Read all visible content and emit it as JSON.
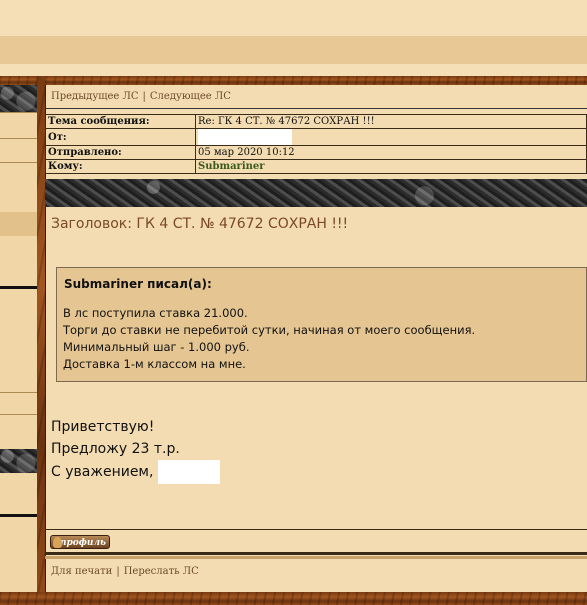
{
  "nav": {
    "prev": "Предыдущее ЛС",
    "separator": "|",
    "next": "Следующее ЛС"
  },
  "header": [
    {
      "key": "Тема сообщения:",
      "value": "Re: ГК 4 СТ. № 47672 СОХРАН !!!"
    },
    {
      "key": "От:",
      "value": ""
    },
    {
      "key": "Отправлено:",
      "value": "05 мар 2020 10:12"
    },
    {
      "key": "Кому:",
      "value": "Submariner"
    }
  ],
  "subject": "Заголовок: ГК 4 СТ. № 47672 СОХРАН !!!",
  "quote": {
    "author": "Submariner писал(а):",
    "lines": [
      "В лс поступила ставка 21.000.",
      "Торги до ставки не перебитой сутки, начиная от моего сообщения.",
      "Минимальный шаг - 1.000 руб.",
      "Доставка 1-м классом на мне."
    ]
  },
  "message": {
    "line1": "Приветствую!",
    "line2": "Предложу 23 т.р.",
    "line3": "С уважением,"
  },
  "profile_button": "профиль",
  "footer": {
    "print": "Для печати",
    "separator": "|",
    "forward": "Переслать ЛС"
  },
  "colors": {
    "accent_link": "#3a5b1a",
    "background": "#f3dcb1",
    "quote_bg": "#e5c692"
  }
}
